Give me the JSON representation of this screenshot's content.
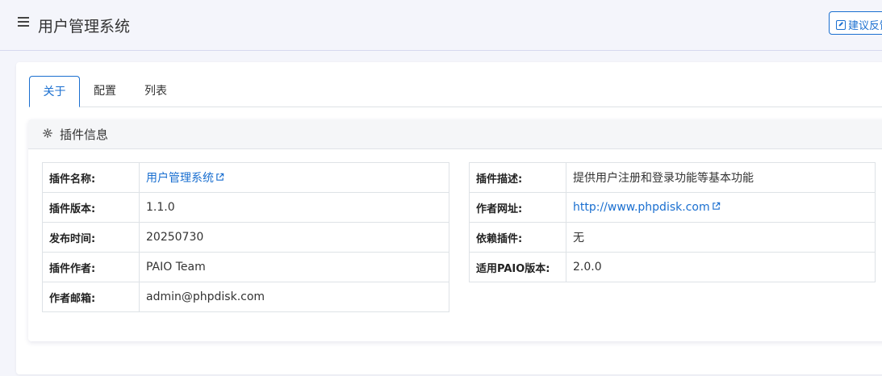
{
  "header": {
    "title": "用户管理系统",
    "feedback_label": "建议反馈"
  },
  "tabs": [
    {
      "label": "关于",
      "active": true
    },
    {
      "label": "配置",
      "active": false
    },
    {
      "label": "列表",
      "active": false
    }
  ],
  "panel": {
    "title": "插件信息"
  },
  "left_table": [
    {
      "key": "插件名称:",
      "value": "用户管理系统"
    },
    {
      "key": "插件版本:",
      "value": "1.1.0"
    },
    {
      "key": "发布时间:",
      "value": "20250730"
    },
    {
      "key": "插件作者:",
      "value": "PAIO Team"
    },
    {
      "key": "作者邮箱:",
      "value": "admin@phpdisk.com"
    }
  ],
  "right_table": [
    {
      "key": "插件描述:",
      "value": "提供用户注册和登录功能等基本功能"
    },
    {
      "key": "作者网址:",
      "value": "http://www.phpdisk.com"
    },
    {
      "key": "依赖插件:",
      "value": "无"
    },
    {
      "key": "适用PAIO版本:",
      "value": "2.0.0"
    }
  ],
  "colors": {
    "accent": "#1a6fd0",
    "background": "#f4f5fb"
  },
  "icons": [
    "menu-icon",
    "edit-icon",
    "gear-icon",
    "external-link-icon"
  ]
}
